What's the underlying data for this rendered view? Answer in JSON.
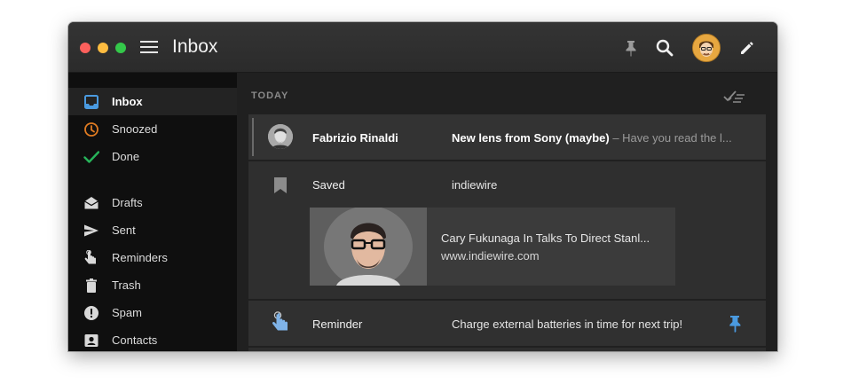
{
  "window": {
    "title": "Inbox"
  },
  "toolbar": {
    "pin_icon": "pin-icon",
    "search_icon": "search-icon",
    "avatar_icon": "user-avatar",
    "compose_icon": "pencil-icon"
  },
  "sidebar": {
    "items": [
      {
        "label": "Inbox",
        "icon": "inbox-icon",
        "color": "#4a9ae0",
        "active": true
      },
      {
        "label": "Snoozed",
        "icon": "clock-icon",
        "color": "#e07b22"
      },
      {
        "label": "Done",
        "icon": "checkmark-icon",
        "color": "#27b45a"
      },
      {
        "label": "Drafts",
        "icon": "drafts-envelope-icon",
        "color": "#d8d8d8"
      },
      {
        "label": "Sent",
        "icon": "send-icon",
        "color": "#d8d8d8"
      },
      {
        "label": "Reminders",
        "icon": "reminder-hand-icon",
        "color": "#d8d8d8"
      },
      {
        "label": "Trash",
        "icon": "trash-icon",
        "color": "#d8d8d8"
      },
      {
        "label": "Spam",
        "icon": "spam-icon",
        "color": "#d8d8d8"
      },
      {
        "label": "Contacts",
        "icon": "contacts-icon",
        "color": "#d8d8d8"
      }
    ]
  },
  "main": {
    "section_label": "TODAY",
    "sweep_icon": "sweep-done-icon",
    "messages": [
      {
        "sender": "Fabrizio Rinaldi",
        "subject": "New lens from Sony (maybe)",
        "snippet": " – Have you read the l..."
      },
      {
        "sender": "Saved",
        "subject": "indiewire",
        "card_title": "Cary Fukunaga In Talks To Direct Stanl...",
        "card_url": "www.indiewire.com"
      },
      {
        "sender": "Reminder",
        "subject": "Charge external batteries in time for next trip!"
      }
    ]
  },
  "colors": {
    "accent_blue": "#4a9ae0",
    "snooze_orange": "#e07b22",
    "done_green": "#27b45a"
  }
}
